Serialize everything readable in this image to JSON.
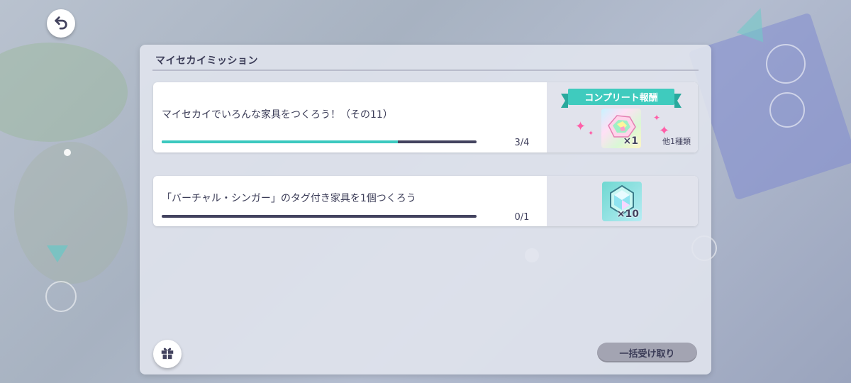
{
  "header": {
    "back_icon": "undo-arrow-icon"
  },
  "panel": {
    "title": "マイセカイミッション"
  },
  "missions": [
    {
      "text": "マイセカイでいろんな家具をつくろう！（その11）",
      "progress_current": 3,
      "progress_total": 4,
      "progress_label": "3/4",
      "progress_fraction": 0.75,
      "reward": {
        "banner": "コンプリート報酬",
        "item_icon": "gem-cluster-icon",
        "quantity": "×1",
        "note": "他1種類"
      }
    },
    {
      "text": "「バーチャル・シンガー」のタグ付き家具を1個つくろう",
      "progress_current": 0,
      "progress_total": 1,
      "progress_label": "0/1",
      "progress_fraction": 0,
      "reward": {
        "item_icon": "crystal-icon",
        "quantity": "×10"
      }
    }
  ],
  "footer": {
    "gift_icon": "gift-box-icon",
    "bulk_receive_label": "一括受け取り"
  },
  "colors": {
    "accent": "#3cc9bf",
    "text": "#3b3c57",
    "progress_track": "#43435f",
    "sparkle": "#ff5fa8"
  }
}
